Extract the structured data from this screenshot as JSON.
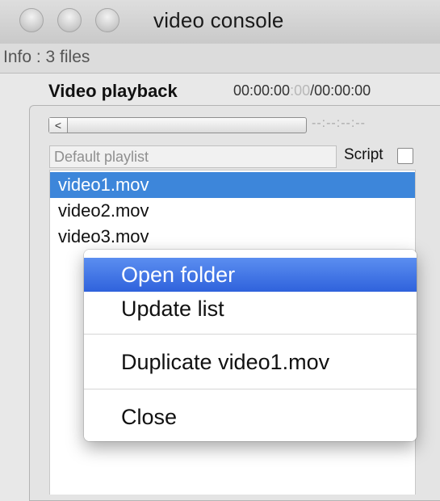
{
  "window": {
    "title": "video console",
    "buttons": [
      "close-button",
      "minimize-button",
      "zoom-button"
    ]
  },
  "info": {
    "text": "Info : 3 files"
  },
  "playback": {
    "section_title": "Video playback",
    "timecode_main": "00:00:00",
    "timecode_frames": ":00",
    "timecode_total": "/00:00:00",
    "scrub_button": "<",
    "scrub_time": "--:--:--:--"
  },
  "playlist": {
    "placeholder": "Default playlist",
    "script_label": "Script",
    "script_checked": false,
    "items": [
      "video1.mov",
      "video2.mov",
      "video3.mov"
    ],
    "selected_index": 0
  },
  "context_menu": {
    "items": [
      "Open folder",
      "Update list",
      "Duplicate video1.mov",
      "Close"
    ],
    "highlighted_index": 0
  },
  "colors": {
    "selection": "#3d86da",
    "menu_highlight": "#2f62dc"
  }
}
